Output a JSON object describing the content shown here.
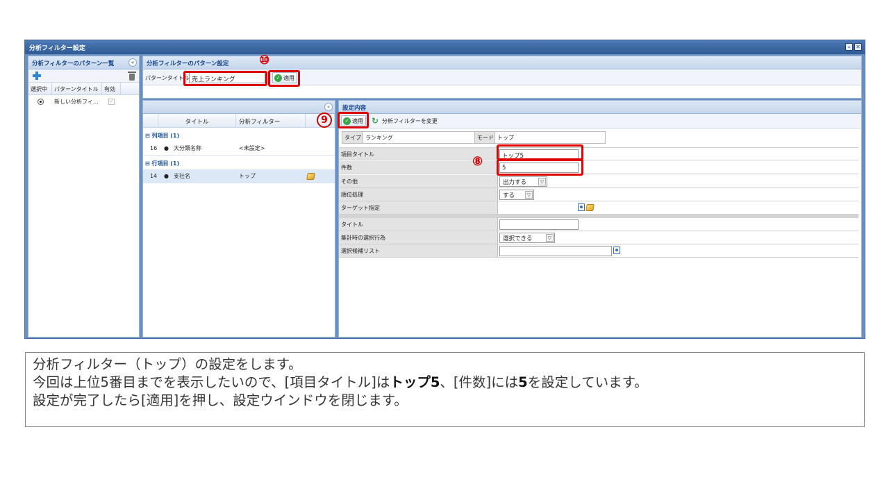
{
  "window": {
    "title": "分析フィルター設定"
  },
  "left_panel": {
    "title": "分析フィルターのパターン一覧",
    "columns": [
      "選択中",
      "パターンタイトル",
      "有効"
    ],
    "rows": [
      {
        "title": "新しい分析フィ…"
      }
    ]
  },
  "pattern": {
    "title": "分析フィルターのパターン設定",
    "label": "パターンタイトル",
    "value": "売上ランキング",
    "apply": "適用"
  },
  "field_list": {
    "columns": [
      "タイトル",
      "分析フィルター"
    ],
    "groups": [
      {
        "label": "⊟ 列項目 (1)",
        "rows": [
          {
            "num": "16",
            "name": "大分類名称",
            "filter": "<未設定>"
          }
        ]
      },
      {
        "label": "⊟ 行項目 (1)",
        "rows": [
          {
            "num": "14",
            "name": "支社名",
            "filter": "トップ"
          }
        ]
      }
    ]
  },
  "settings": {
    "title": "設定内容",
    "apply": "適用",
    "change_filter": "分析フィルターを変更",
    "type_label": "タイプ",
    "type_value": "ランキング",
    "mode_label": "モード",
    "mode_value": "トップ",
    "props": {
      "item_title": {
        "label": "項目タイトル",
        "value": "トップ5"
      },
      "count": {
        "label": "件数",
        "value": "5"
      },
      "other": {
        "label": "その他",
        "value": "出力する"
      },
      "rank": {
        "label": "順位処理",
        "value": "する"
      },
      "target": {
        "label": "ターゲット指定"
      },
      "title": {
        "label": "タイトル",
        "value": ""
      },
      "agg_select": {
        "label": "集計時の選択行為",
        "value": "選択できる"
      },
      "candidate": {
        "label": "選択候補リスト",
        "value": ""
      }
    }
  },
  "callouts": {
    "n8": "⑧",
    "n9": "9",
    "n10": "⑩"
  },
  "caption": {
    "line1": "分析フィルター（トップ）の設定をします。",
    "line2_a": "今回は上位5番目までを表示したいので、[項目タイトル]は",
    "line2_b": "トップ5",
    "line2_c": "、[件数]には",
    "line2_d": "5",
    "line2_e": "を設定しています。",
    "line3": "設定が完了したら[適用]を押し、設定ウインドウを閉じます。"
  },
  "colors": {
    "highlight": "#e00000",
    "titlebar": "#2f5a94",
    "accent_text": "#15438b"
  }
}
